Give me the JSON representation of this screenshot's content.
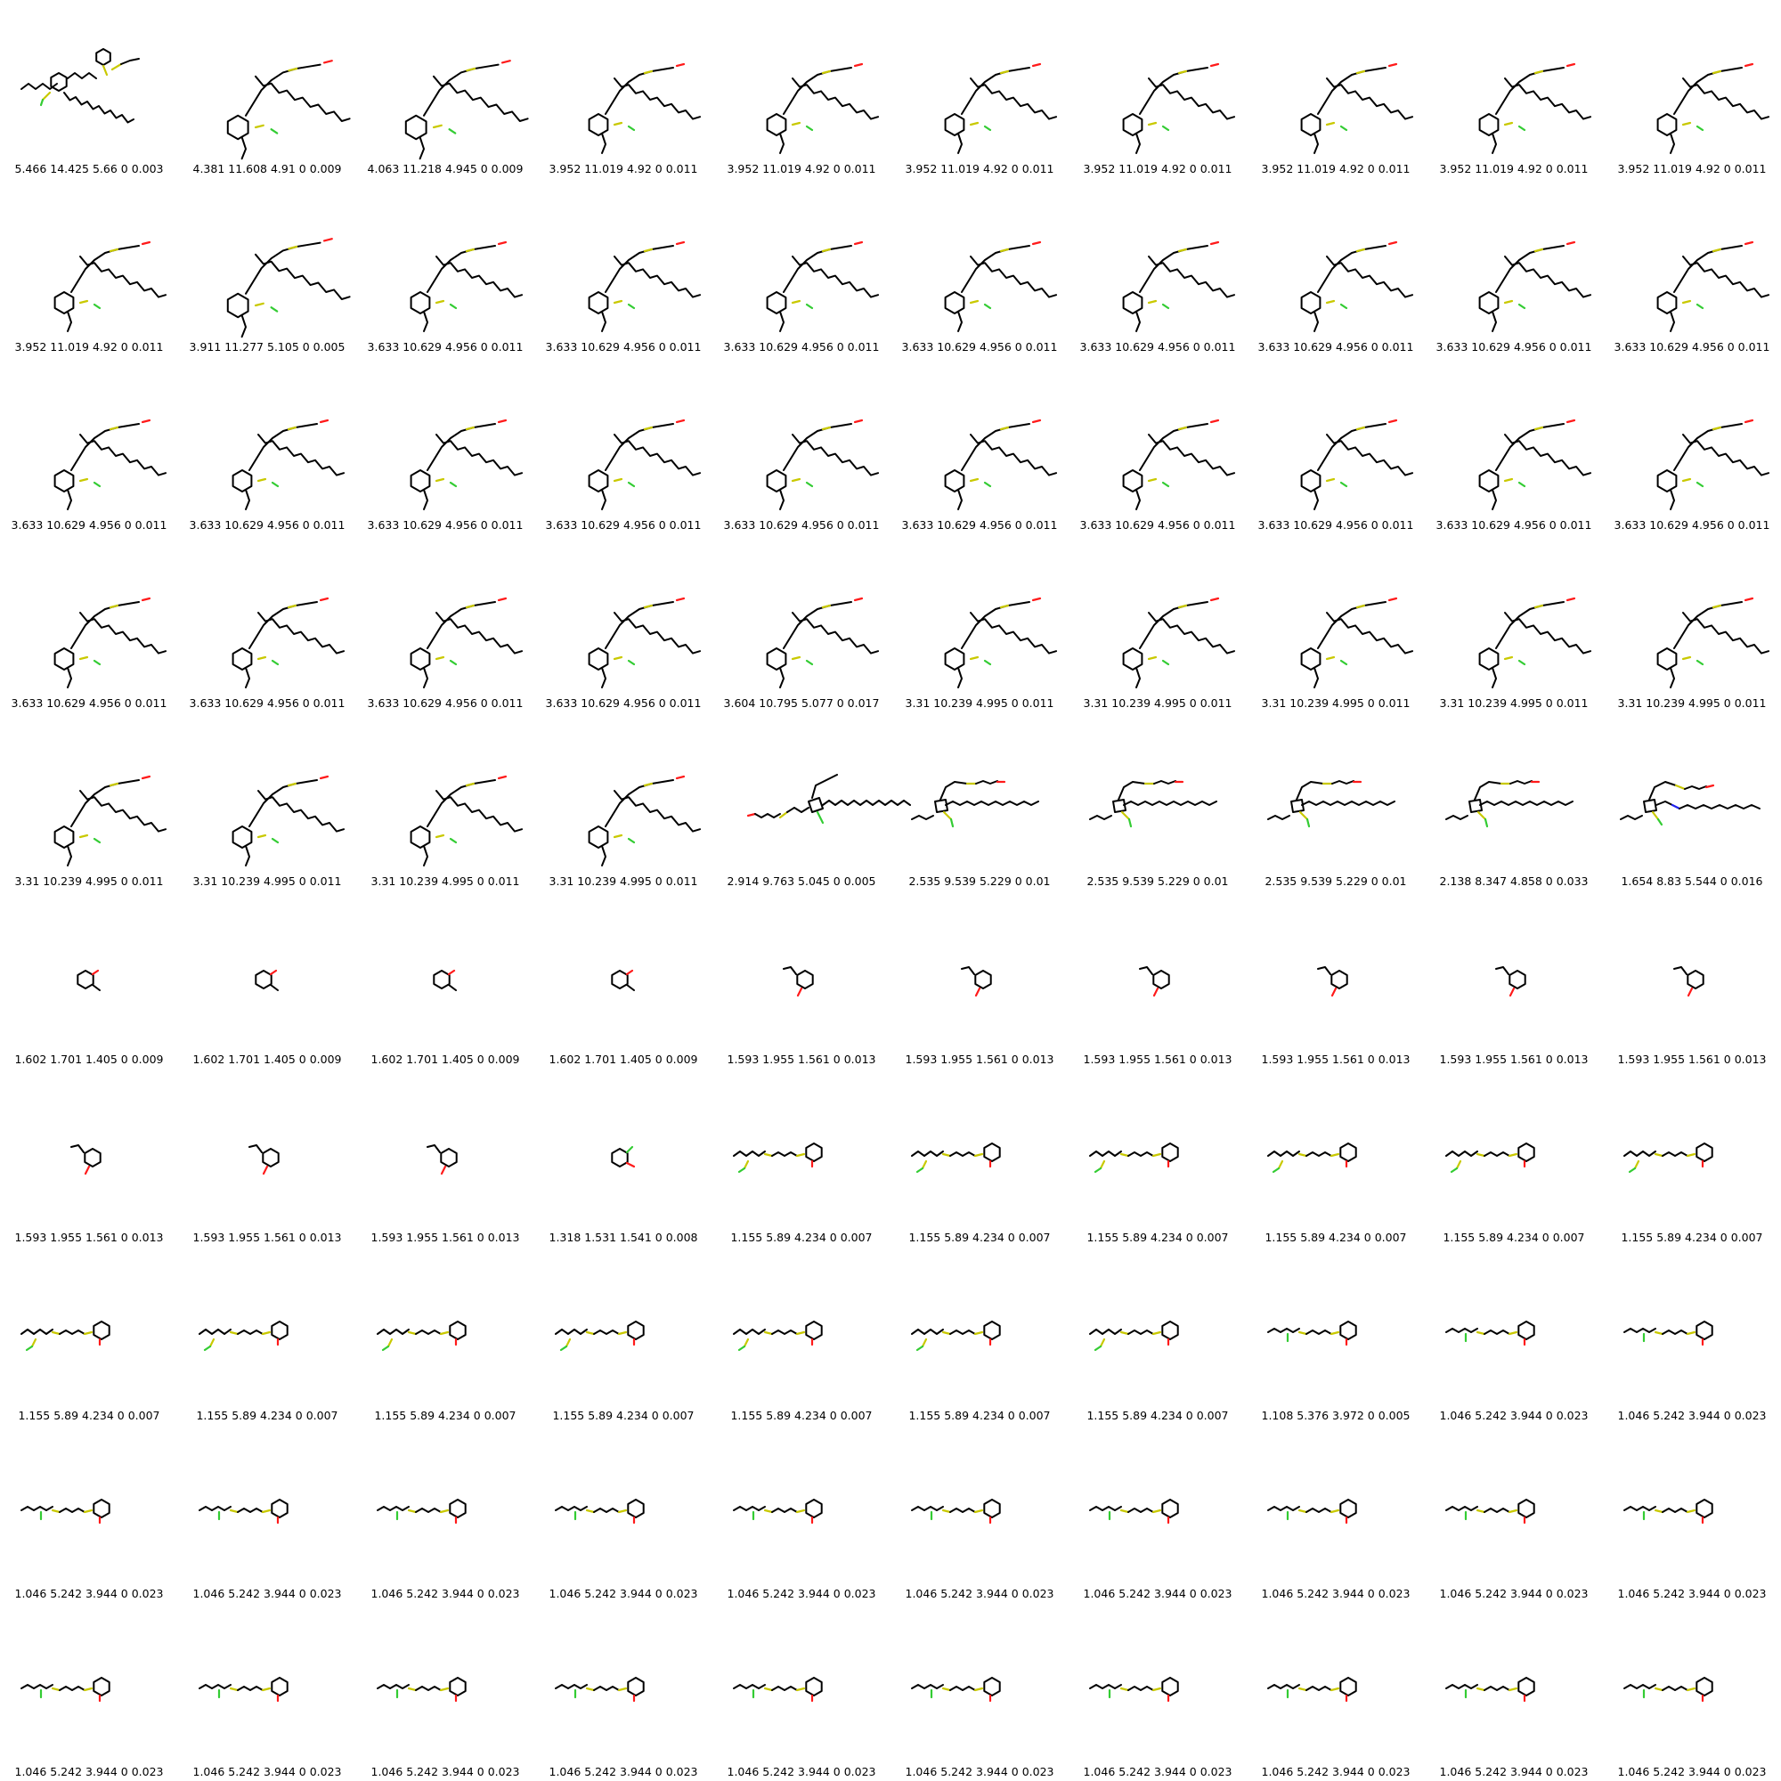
{
  "grid": {
    "columns": 10,
    "rows": 10,
    "labels": [
      "5.466 14.425 5.66 0 0.003",
      "4.381 11.608 4.91 0 0.009",
      "4.063 11.218 4.945 0 0.009",
      "3.952 11.019 4.92 0 0.011",
      "3.952 11.019 4.92 0 0.011",
      "3.952 11.019 4.92 0 0.011",
      "3.952 11.019 4.92 0 0.011",
      "3.952 11.019 4.92 0 0.011",
      "3.952 11.019 4.92 0 0.011",
      "3.952 11.019 4.92 0 0.011",
      "3.952 11.019 4.92 0 0.011",
      "3.911 11.277 5.105 0 0.005",
      "3.633 10.629 4.956 0 0.011",
      "3.633 10.629 4.956 0 0.011",
      "3.633 10.629 4.956 0 0.011",
      "3.633 10.629 4.956 0 0.011",
      "3.633 10.629 4.956 0 0.011",
      "3.633 10.629 4.956 0 0.011",
      "3.633 10.629 4.956 0 0.011",
      "3.633 10.629 4.956 0 0.011",
      "3.633 10.629 4.956 0 0.011",
      "3.633 10.629 4.956 0 0.011",
      "3.633 10.629 4.956 0 0.011",
      "3.633 10.629 4.956 0 0.011",
      "3.633 10.629 4.956 0 0.011",
      "3.633 10.629 4.956 0 0.011",
      "3.633 10.629 4.956 0 0.011",
      "3.633 10.629 4.956 0 0.011",
      "3.633 10.629 4.956 0 0.011",
      "3.633 10.629 4.956 0 0.011",
      "3.633 10.629 4.956 0 0.011",
      "3.633 10.629 4.956 0 0.011",
      "3.633 10.629 4.956 0 0.011",
      "3.633 10.629 4.956 0 0.011",
      "3.604 10.795 5.077 0 0.017",
      "3.31 10.239 4.995 0 0.011",
      "3.31 10.239 4.995 0 0.011",
      "3.31 10.239 4.995 0 0.011",
      "3.31 10.239 4.995 0 0.011",
      "3.31 10.239 4.995 0 0.011",
      "3.31 10.239 4.995 0 0.011",
      "3.31 10.239 4.995 0 0.011",
      "3.31 10.239 4.995 0 0.011",
      "3.31 10.239 4.995 0 0.011",
      "2.914 9.763 5.045 0 0.005",
      "2.535 9.539 5.229 0 0.01",
      "2.535 9.539 5.229 0 0.01",
      "2.535 9.539 5.229 0 0.01",
      "2.138 8.347 4.858 0 0.033",
      "1.654 8.83 5.544 0 0.016",
      "1.602 1.701 1.405 0 0.009",
      "1.602 1.701 1.405 0 0.009",
      "1.602 1.701 1.405 0 0.009",
      "1.602 1.701 1.405 0 0.009",
      "1.593 1.955 1.561 0 0.013",
      "1.593 1.955 1.561 0 0.013",
      "1.593 1.955 1.561 0 0.013",
      "1.593 1.955 1.561 0 0.013",
      "1.593 1.955 1.561 0 0.013",
      "1.593 1.955 1.561 0 0.013",
      "1.593 1.955 1.561 0 0.013",
      "1.593 1.955 1.561 0 0.013",
      "1.593 1.955 1.561 0 0.013",
      "1.318 1.531 1.541 0 0.008",
      "1.155 5.89 4.234 0 0.007",
      "1.155 5.89 4.234 0 0.007",
      "1.155 5.89 4.234 0 0.007",
      "1.155 5.89 4.234 0 0.007",
      "1.155 5.89 4.234 0 0.007",
      "1.155 5.89 4.234 0 0.007",
      "1.155 5.89 4.234 0 0.007",
      "1.155 5.89 4.234 0 0.007",
      "1.155 5.89 4.234 0 0.007",
      "1.155 5.89 4.234 0 0.007",
      "1.155 5.89 4.234 0 0.007",
      "1.155 5.89 4.234 0 0.007",
      "1.155 5.89 4.234 0 0.007",
      "1.108 5.376 3.972 0 0.005",
      "1.046 5.242 3.944 0 0.023",
      "1.046 5.242 3.944 0 0.023",
      "1.046 5.242 3.944 0 0.023",
      "1.046 5.242 3.944 0 0.023",
      "1.046 5.242 3.944 0 0.023",
      "1.046 5.242 3.944 0 0.023",
      "1.046 5.242 3.944 0 0.023",
      "1.046 5.242 3.944 0 0.023",
      "1.046 5.242 3.944 0 0.023",
      "1.046 5.242 3.944 0 0.023",
      "1.046 5.242 3.944 0 0.023",
      "1.046 5.242 3.944 0 0.023",
      "1.046 5.242 3.944 0 0.023",
      "1.046 5.242 3.944 0 0.023",
      "1.046 5.242 3.944 0 0.023",
      "1.046 5.242 3.944 0 0.023",
      "1.046 5.242 3.944 0 0.023",
      "1.046 5.242 3.944 0 0.023",
      "1.046 5.242 3.944 0 0.023",
      "1.046 5.242 3.944 0 0.023",
      "1.046 5.242 3.944 0 0.023",
      "1.046 5.242 3.944 0 0.023"
    ],
    "molecule_types": [
      "A",
      "B",
      "B",
      "C",
      "C",
      "C",
      "C",
      "C",
      "C",
      "C",
      "C",
      "B",
      "C",
      "C",
      "C",
      "C",
      "C",
      "C",
      "C",
      "C",
      "C",
      "C",
      "C",
      "C",
      "C",
      "C",
      "C",
      "C",
      "C",
      "C",
      "C",
      "C",
      "C",
      "C",
      "C",
      "C",
      "C",
      "C",
      "C",
      "C",
      "C",
      "C",
      "C",
      "C",
      "D",
      "E",
      "E",
      "E",
      "E",
      "F",
      "G",
      "G",
      "G",
      "G",
      "H",
      "H",
      "H",
      "H",
      "H",
      "H",
      "H",
      "H",
      "H",
      "I",
      "J",
      "J",
      "J",
      "J",
      "J",
      "J",
      "J",
      "J",
      "J",
      "J",
      "J",
      "J",
      "J",
      "K",
      "K",
      "K",
      "K",
      "K",
      "K",
      "K",
      "K",
      "K",
      "K",
      "K",
      "K",
      "K",
      "K",
      "K",
      "K",
      "K",
      "K",
      "K",
      "K",
      "K",
      "K",
      "K"
    ]
  },
  "atom_colors": {
    "carbon": "#000000",
    "sulfur": "#c9c900",
    "oxygen": "#ff1a1a",
    "fluorine": "#33cc33",
    "nitrogen": "#2222ee"
  }
}
